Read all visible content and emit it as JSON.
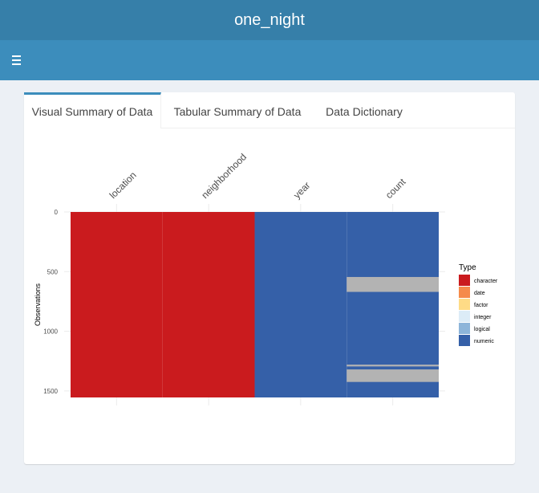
{
  "app": {
    "title": "one_night"
  },
  "navbar": {
    "menu_icon": "hamburger-menu-icon"
  },
  "tabs": [
    {
      "label": "Visual Summary of Data",
      "active": true
    },
    {
      "label": "Tabular Summary of Data",
      "active": false
    },
    {
      "label": "Data Dictionary",
      "active": false
    }
  ],
  "colors": {
    "header": "#367fa9",
    "navbar": "#3c8dbc",
    "character": "#ca1b1e",
    "date": "#f58b4b",
    "factor": "#fedb86",
    "integer": "#dcecf7",
    "logical": "#8db5d9",
    "numeric": "#3560a8",
    "missing": "#b3b3b3"
  },
  "chart_data": {
    "type": "heatmap",
    "columns": [
      "location",
      "neighborhood",
      "year",
      "count"
    ],
    "column_types": [
      "character",
      "character",
      "numeric",
      "numeric"
    ],
    "ylabel": "Observations",
    "yticks": [
      0,
      500,
      1000,
      1500
    ],
    "n_observations": 1555,
    "missing": [
      {
        "column": "count",
        "from": 545,
        "to": 670
      },
      {
        "column": "count",
        "from": 1280,
        "to": 1295
      },
      {
        "column": "count",
        "from": 1320,
        "to": 1425
      }
    ],
    "legend": {
      "title": "Type",
      "entries": [
        "character",
        "date",
        "factor",
        "integer",
        "logical",
        "numeric"
      ]
    }
  }
}
